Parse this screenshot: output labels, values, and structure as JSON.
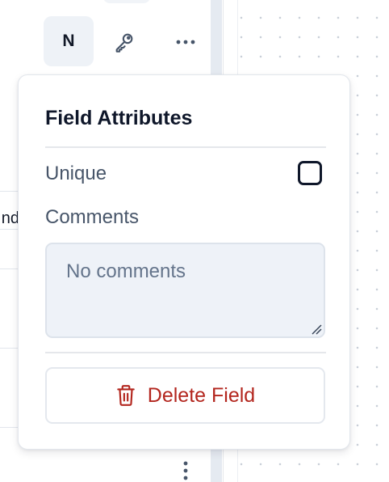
{
  "toolbar": {
    "nullable_label": "N",
    "key_icon": "key-icon",
    "more_icon": "ellipsis-horizontal-icon",
    "row_more_icon": "ellipsis-vertical-icon"
  },
  "left_panel": {
    "row_text": "nd"
  },
  "popover": {
    "title": "Field Attributes",
    "unique_label": "Unique",
    "unique_checked": false,
    "comments_label": "Comments",
    "comments_placeholder": "No comments",
    "comments_value": "",
    "delete_label": "Delete Field",
    "delete_icon": "trash-icon"
  },
  "colors": {
    "danger": "#b3261e",
    "text_primary": "#0f172a",
    "text_muted": "#475569",
    "input_bg": "#eef2f8"
  }
}
